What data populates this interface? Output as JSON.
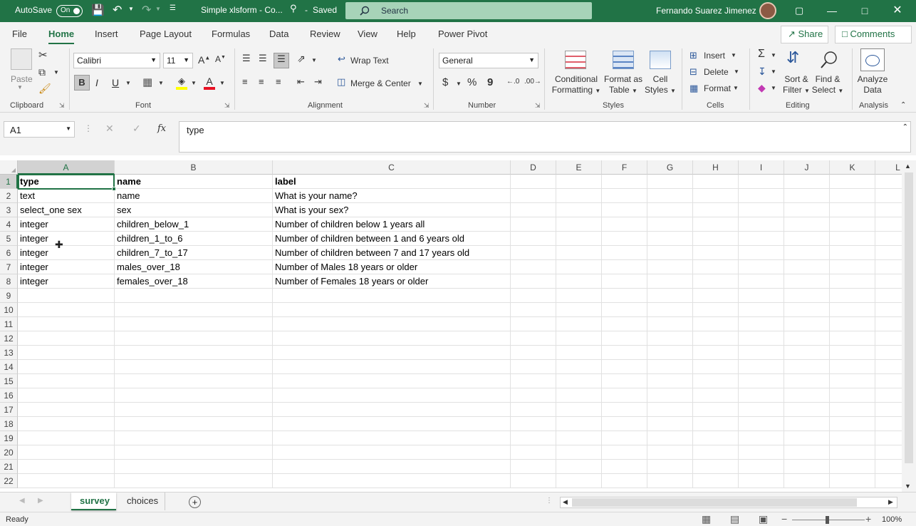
{
  "titlebar": {
    "autosave_label": "AutoSave",
    "autosave_state": "On",
    "doc_title": "Simple xlsform - Co...",
    "saved_status": "Saved",
    "search_placeholder": "Search",
    "user_name": "Fernando Suarez Jimenez",
    "accent_color": "#217346"
  },
  "menu": {
    "tabs": [
      "File",
      "Home",
      "Insert",
      "Page Layout",
      "Formulas",
      "Data",
      "Review",
      "View",
      "Help",
      "Power Pivot"
    ],
    "active_tab": "Home",
    "share_label": "Share",
    "comments_label": "Comments"
  },
  "ribbon": {
    "clipboard": {
      "paste": "Paste",
      "group": "Clipboard"
    },
    "font": {
      "name": "Calibri",
      "size": "11",
      "bold": "B",
      "italic": "I",
      "underline": "U",
      "group": "Font"
    },
    "alignment": {
      "wrap": "Wrap Text",
      "merge": "Merge & Center",
      "group": "Alignment"
    },
    "number": {
      "format": "General",
      "currency": "$",
      "percent": "%",
      "comma": "9",
      "group": "Number"
    },
    "styles": {
      "conditional_1": "Conditional",
      "conditional_2": "Formatting",
      "format_table_1": "Format as",
      "format_table_2": "Table",
      "cell_styles_1": "Cell",
      "cell_styles_2": "Styles",
      "group": "Styles"
    },
    "cells": {
      "insert": "Insert",
      "delete": "Delete",
      "format": "Format",
      "group": "Cells"
    },
    "editing": {
      "sort_1": "Sort &",
      "sort_2": "Filter",
      "find_1": "Find &",
      "find_2": "Select",
      "group": "Editing"
    },
    "analysis": {
      "analyze_1": "Analyze",
      "analyze_2": "Data",
      "group": "Analysis"
    }
  },
  "formula_bar": {
    "name_box": "A1",
    "fx": "fx",
    "content": "type"
  },
  "grid": {
    "columns": [
      "A",
      "B",
      "C",
      "D",
      "E",
      "F",
      "G",
      "H",
      "I",
      "J",
      "K",
      "L"
    ],
    "row_numbers": [
      "1",
      "2",
      "3",
      "4",
      "5",
      "6",
      "7",
      "8",
      "9",
      "10",
      "11",
      "12",
      "13",
      "14",
      "15",
      "16",
      "17",
      "18",
      "19",
      "20",
      "21",
      "22"
    ],
    "rows": [
      [
        "type",
        "name",
        "label"
      ],
      [
        "text",
        "name",
        "What is your name?"
      ],
      [
        "select_one sex",
        "sex",
        "What is your sex?"
      ],
      [
        "integer",
        "children_below_1",
        "Number of children below 1 years all"
      ],
      [
        "integer",
        "children_1_to_6",
        "Number of children between 1 and 6 years old"
      ],
      [
        "integer",
        "children_7_to_17",
        "Number of children between 7 and 17 years old"
      ],
      [
        "integer",
        "males_over_18",
        "Number of Males 18 years or older"
      ],
      [
        "integer",
        "females_over_18",
        "Number of Females 18 years or older"
      ]
    ],
    "selected_cell": "A1"
  },
  "sheets": {
    "tabs": [
      "survey",
      "choices"
    ],
    "active": "survey"
  },
  "status": {
    "text": "Ready",
    "zoom": "100%"
  }
}
